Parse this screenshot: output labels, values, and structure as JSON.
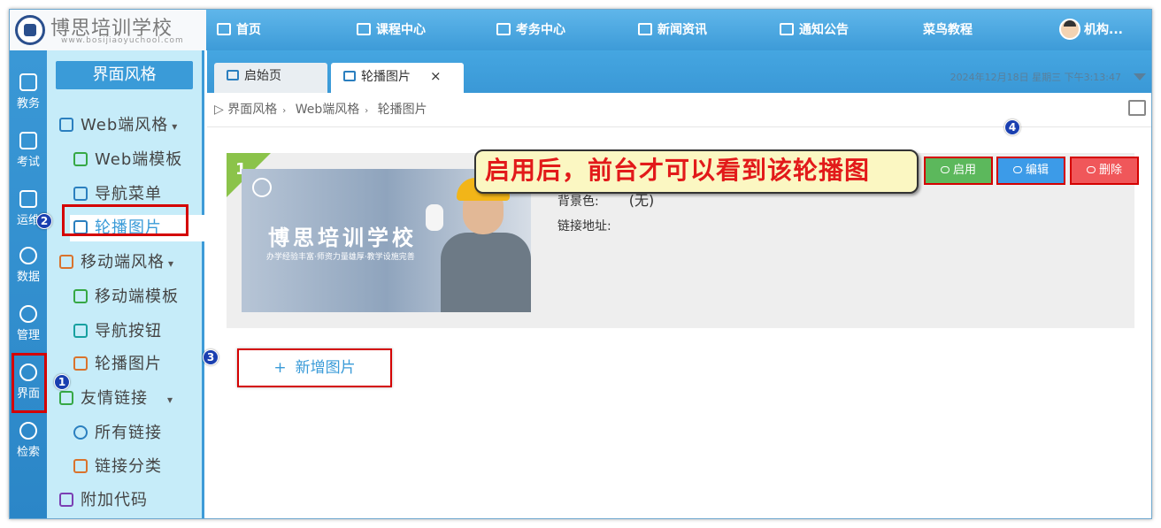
{
  "logo": {
    "title": "博思培训学校",
    "subtitle": "www.bosijiaoyuchool.com"
  },
  "topnav": [
    {
      "label": "首页",
      "icon": "home-icon"
    },
    {
      "label": "课程中心",
      "icon": "book-icon"
    },
    {
      "label": "考务中心",
      "icon": "exam-icon"
    },
    {
      "label": "新闻资讯",
      "icon": "news-icon"
    },
    {
      "label": "通知公告",
      "icon": "megaphone-icon"
    },
    {
      "label": "菜鸟教程",
      "icon": ""
    },
    {
      "label": "机构...",
      "icon": "avatar"
    }
  ],
  "rail": [
    {
      "label": "教务",
      "icon": "books-icon"
    },
    {
      "label": "考试",
      "icon": "exam-icon"
    },
    {
      "label": "运维",
      "icon": "gear-screen-icon"
    },
    {
      "label": "数据",
      "icon": "pie-chart-icon"
    },
    {
      "label": "管理",
      "icon": "gear-icon"
    },
    {
      "label": "界面",
      "icon": "ui-icon"
    },
    {
      "label": "检索",
      "icon": "search-icon"
    }
  ],
  "sidebar": {
    "header": "界面风格",
    "items": [
      {
        "label": "Web端风格",
        "icon": "monitor-icon",
        "caret": "▾"
      },
      {
        "label": "Web端模板",
        "icon": "shirt-icon"
      },
      {
        "label": "导航菜单",
        "icon": "menu-tree-icon"
      },
      {
        "label": "轮播图片",
        "icon": "carousel-icon"
      },
      {
        "label": "移动端风格",
        "icon": "mobile-icon",
        "caret": "▾"
      },
      {
        "label": "移动端模板",
        "icon": "mobile-icon"
      },
      {
        "label": "导航按钮",
        "icon": "grid-icon"
      },
      {
        "label": "轮播图片",
        "icon": "carousel-icon"
      },
      {
        "label": "友情链接",
        "icon": "link-icon",
        "caret": "▾"
      },
      {
        "label": "所有链接",
        "icon": "globe-icon"
      },
      {
        "label": "链接分类",
        "icon": "category-icon"
      },
      {
        "label": "附加代码",
        "icon": "code-icon"
      }
    ]
  },
  "tabs": [
    {
      "label": "启始页",
      "icon": "home-icon"
    },
    {
      "label": "轮播图片",
      "icon": "carousel-icon",
      "close": "×"
    }
  ],
  "datetime": "2024年12月18日 星期三 下午3:13:47",
  "breadcrumb": [
    "界面风格",
    "Web端风格",
    "轮播图片"
  ],
  "card": {
    "index": "1",
    "banner_title": "博思培训学校",
    "banner_sub": "办学经验丰富·师资力量雄厚·教学设施完善",
    "bg_label": "背景色:",
    "bg_value": "(无)",
    "link_label": "链接地址:"
  },
  "actions": {
    "enable": "启用",
    "edit": "编辑",
    "delete": "删除"
  },
  "add_button": {
    "plus": "+",
    "label": "新增图片"
  },
  "callout": "启用后，前台才可以看到该轮播图",
  "steps": [
    "1",
    "2",
    "3",
    "4"
  ],
  "colors": {
    "primary": "#3a9bd8",
    "sidebar_bg": "#c6ecf9",
    "enable": "#5cb85c",
    "edit": "#3c9be8",
    "delete": "#f0575a",
    "annotation": "#d40000"
  }
}
